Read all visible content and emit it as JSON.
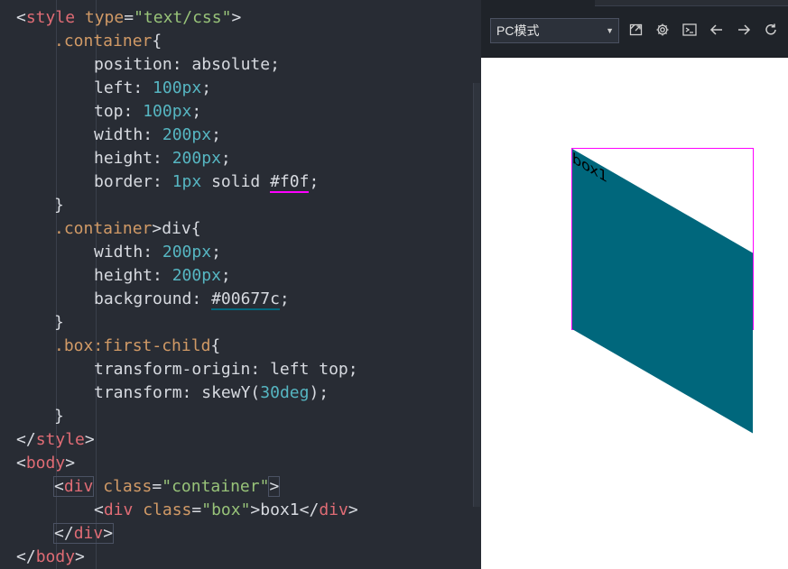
{
  "editor": {
    "lines": [
      {
        "open": "<",
        "tag": "style",
        "attr": " type",
        "eq": "=",
        "str": "\"text/css\"",
        "close": ">"
      },
      {
        "selector": ".container",
        "brace": "{"
      },
      {
        "prop": "position",
        "value": "absolute;"
      },
      {
        "prop": "left",
        "num": "100px",
        "end": ";"
      },
      {
        "prop": "top",
        "num": "100px",
        "end": ";"
      },
      {
        "prop": "width",
        "num": "200px",
        "end": ";"
      },
      {
        "prop": "height",
        "num": "200px",
        "end": ";"
      },
      {
        "prop": "border",
        "num": "1px",
        "mid": " solid ",
        "color": "#f0f",
        "end": ";"
      },
      {
        "brace": "}"
      },
      {
        "selector": ".container",
        "rest": ">div{"
      },
      {
        "prop": "width",
        "num": "200px",
        "end": ";"
      },
      {
        "prop": "height",
        "num": "200px",
        "end": ";"
      },
      {
        "prop": "background",
        "color": "#00677c",
        "end": ";"
      },
      {
        "brace": "}"
      },
      {
        "selector": ".box",
        "pseudo": ":first-child",
        "brace": "{"
      },
      {
        "prop": "transform-origin",
        "value": "left top;"
      },
      {
        "prop": "transform",
        "value": "skewY(",
        "num": "30deg",
        "end": ");"
      },
      {
        "brace": "}"
      },
      {
        "open": "</",
        "tag": "style",
        "close": ">"
      },
      {
        "open": "<",
        "tag": "body",
        "close": ">"
      },
      {
        "open": "<",
        "tag": "div",
        "attr": " class",
        "eq": "=",
        "str": "\"container\"",
        "close": ">"
      },
      {
        "open": "<",
        "tag": "div",
        "attr": " class",
        "eq": "=",
        "str": "\"box\"",
        "close": ">",
        "text": "box1",
        "open2": "</",
        "tag2": "div",
        "close2": ">"
      },
      {
        "open": "</",
        "tag": "div",
        "close": ">"
      },
      {
        "open": "</",
        "tag": "body",
        "close": ">"
      }
    ]
  },
  "preview": {
    "mode_select": "PC模式",
    "toolbar_icons": [
      "open-external-icon",
      "settings-icon",
      "console-icon",
      "back-arrow-icon",
      "forward-arrow-icon",
      "refresh-icon"
    ],
    "box_label": "box1",
    "colors": {
      "border": "#f0f",
      "box": "#00677c"
    }
  }
}
